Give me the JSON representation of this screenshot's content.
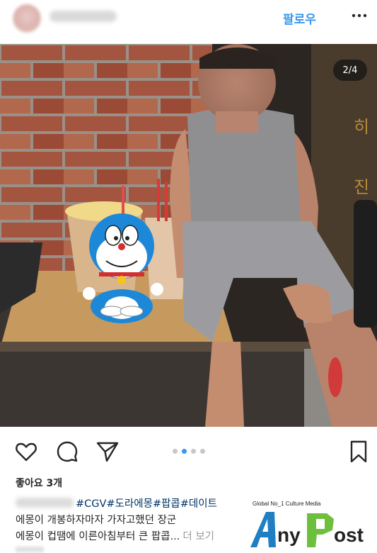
{
  "header": {
    "follow_label": "팔로우",
    "more_icon": "more-horizontal-icon"
  },
  "photo": {
    "counter": "2/4",
    "current_index": 2,
    "total": 4
  },
  "actions": {
    "like_icon": "heart-icon",
    "comment_icon": "comment-icon",
    "share_icon": "send-icon",
    "save_icon": "bookmark-icon",
    "carousel_active_index": 1,
    "carousel_count": 4
  },
  "likes": {
    "text": "좋아요 3개"
  },
  "caption": {
    "hashtags": "#CGV#도라에몽#팝콥#데이트",
    "line2": "에몽이 개봉하자마자 가자고했던 장군",
    "line3": "에몽이 컵땜에 이른아침부터 큰 팝콥...",
    "more_label": "더 보기"
  },
  "watermark": {
    "tagline": "Global No_1 Culture Media",
    "logo_text": "AnyPost"
  },
  "colors": {
    "accent": "#3897f0",
    "hashtag": "#003569",
    "text": "#262626",
    "muted": "#999999"
  }
}
